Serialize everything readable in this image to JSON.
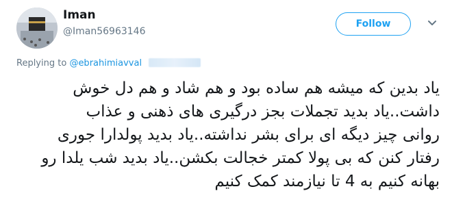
{
  "user": {
    "display_name": "Iman",
    "handle": "@Iman56963146"
  },
  "follow_button": {
    "label": "Follow"
  },
  "icons": {
    "menu": "chevron-down-icon",
    "avatar": "avatar-photo"
  },
  "reply": {
    "prefix": "Replying to",
    "mention": "@ebrahimiavval"
  },
  "tweet": {
    "lines": [
      "یاد بدین که میشه هم ساده بود و هم شاد و هم دل خوش",
      "داشت..یاد بدید تجملات بجز درگیری های ذهنی و عذاب",
      "روانی چیز دیگه ای برای بشر نداشته..یاد بدید پولدارا جوری",
      "رفتار کنن که بی پولا کمتر خجالت بکشن..یاد بدید شب یلدا رو",
      "بهانه کنیم به 4 تا نیازمند کمک کنیم"
    ]
  },
  "colors": {
    "accent": "#1da1f2",
    "muted": "#657786",
    "text": "#14171a"
  }
}
